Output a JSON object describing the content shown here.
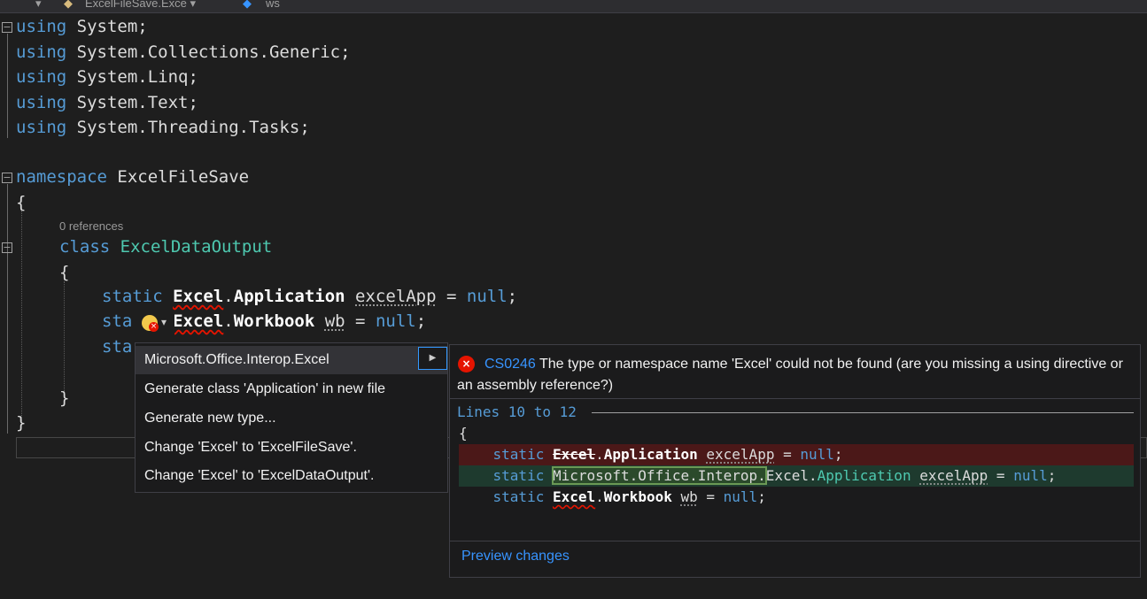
{
  "navbar": {
    "project_dropdown": "▾",
    "class_dropdown": "ExcelFileSave.Exce ▾",
    "member_dropdown": "ws"
  },
  "code": {
    "using_kw": "using",
    "namespaces": [
      "System;",
      "System.Collections.Generic;",
      "System.Linq;",
      "System.Text;",
      "System.Threading.Tasks;"
    ],
    "namespace_kw": "namespace",
    "namespace_name": "ExcelFileSave",
    "open_brace": "{",
    "close_brace": "}",
    "codelens": "0 references",
    "class_kw": "class",
    "class_name": "ExcelDataOutput",
    "static_kw": "static",
    "excel": "Excel",
    "dot": ".",
    "application": "Application",
    "workbook": "Workbook",
    "var_excelapp": "excelApp",
    "var_wb": "wb",
    "eq": " = ",
    "null_kw": "null",
    "semi": ";",
    "sta_fragment_1": "sta",
    "sta_fragment_2": "sta"
  },
  "quick_actions": {
    "items": [
      "Microsoft.Office.Interop.Excel",
      "Generate class 'Application' in new file",
      "Generate new type...",
      "Change 'Excel' to 'ExcelFileSave'.",
      "Change 'Excel' to 'ExcelDataOutput'."
    ],
    "submenu_arrow": "▶"
  },
  "preview": {
    "error_code": "CS0246",
    "error_text": " The type or namespace name 'Excel' could not be found (are you missing a using directive or an assembly reference?)",
    "lines_label": "Lines 10 to 12",
    "brace": "{",
    "interop_prefix": "Microsoft.Office.Interop.",
    "preview_changes": "Preview changes"
  },
  "colors": {
    "keyword": "#569cd6",
    "type": "#4ec9b0",
    "error": "#e51400",
    "link": "#3794ff"
  }
}
